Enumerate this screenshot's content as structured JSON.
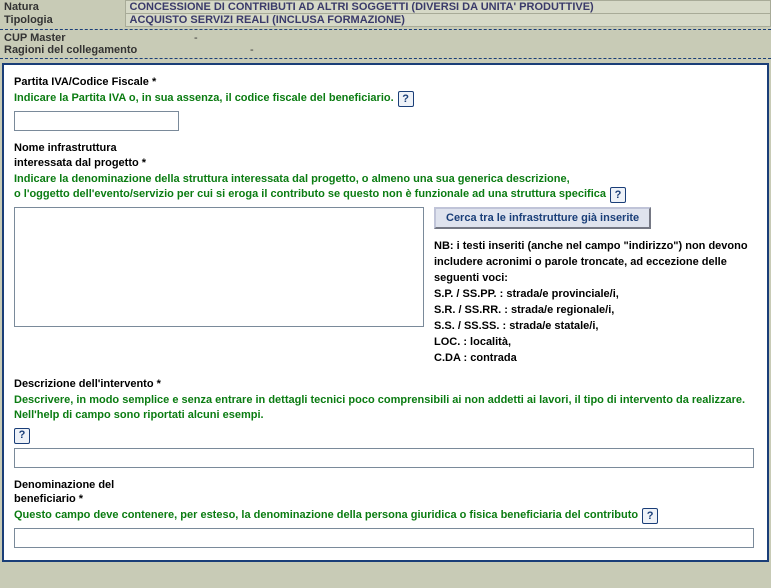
{
  "header": {
    "natura_label": "Natura",
    "natura_value": "CONCESSIONE DI CONTRIBUTI AD ALTRI SOGGETTI (DIVERSI DA UNITA' PRODUTTIVE)",
    "tipologia_label": "Tipologia",
    "tipologia_value": "ACQUISTO SERVIZI REALI (INCLUSA FORMAZIONE)",
    "cup_master_label": "CUP Master",
    "cup_master_value": "-",
    "ragioni_label": "Ragioni del collegamento",
    "ragioni_value": "-"
  },
  "piva": {
    "label": "Partita IVA/Codice Fiscale *",
    "hint": "Indicare la Partita IVA o, in sua assenza, il codice fiscale del beneficiario.",
    "value": ""
  },
  "infra": {
    "label_line1": "Nome infrastruttura",
    "label_line2": "interessata dal progetto *",
    "hint_line1": "Indicare la denominazione della struttura interessata dal progetto, o almeno una sua generica descrizione,",
    "hint_line2": "o l'oggetto dell'evento/servizio per cui si eroga il contributo se questo non è funzionale ad una struttura specifica",
    "value": "",
    "search_button": "Cerca tra le infrastrutture già inserite",
    "nb": {
      "intro": "NB: i testi inseriti (anche nel campo \"indirizzo\") non devono includere acronimi o parole troncate, ad eccezione delle seguenti voci:",
      "l1": "S.P. / SS.PP. : strada/e provinciale/i,",
      "l2": "S.R. / SS.RR. : strada/e regionale/i,",
      "l3": "S.S. / SS.SS. : strada/e statale/i,",
      "l4": "LOC. : località,",
      "l5": "C.DA : contrada"
    }
  },
  "descr": {
    "label": "Descrizione dell'intervento *",
    "hint": "Descrivere, in modo semplice e senza entrare in dettagli tecnici poco comprensibili ai non addetti ai lavori, il tipo di intervento da realizzare. Nell'help di campo sono riportati alcuni esempi.",
    "value": ""
  },
  "benef": {
    "label_line1": "Denominazione del",
    "label_line2": "beneficiario *",
    "hint": "Questo campo deve contenere, per esteso, la denominazione della persona giuridica o fisica beneficiaria del contributo",
    "value": ""
  },
  "help_glyph": "?"
}
